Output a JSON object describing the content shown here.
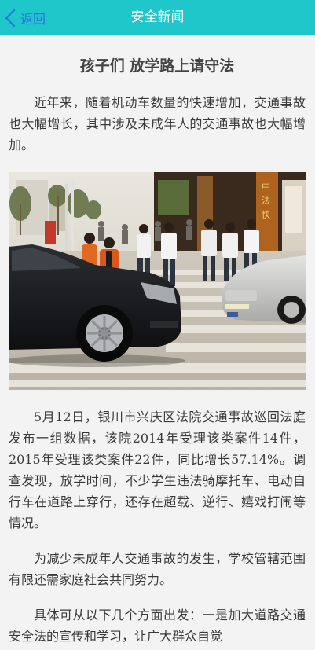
{
  "header": {
    "back_label": "返回",
    "title": "安全新闻",
    "accent_color": "#1fc7cb"
  },
  "article": {
    "title": "孩子们  放学路上请守法",
    "paragraphs": [
      "近年来，随着机动车数量的快速增加，交通事故也大幅增长，其中涉及未成年人的交通事故也大幅增加。",
      "5月12日，银川市兴庆区法院交通事故巡回法庭发布一组数据，该院2014年受理该类案件14件，2015年受理该类案件22件，同比增长57.14%。调查发现，放学时间，不少学生违法骑摩托车、电动自行车在道路上穿行，还存在超载、逆行、嬉戏打闹等情况。",
      "为减少未成年人交通事故的发生，学校管辖范围有限还需家庭社会共同努力。",
      "具体可从以下几个方面出发：一是加大道路交通安全法的宣传和学习，让广大群众自觉"
    ],
    "photo_label": "students-crossing-street-photo"
  }
}
